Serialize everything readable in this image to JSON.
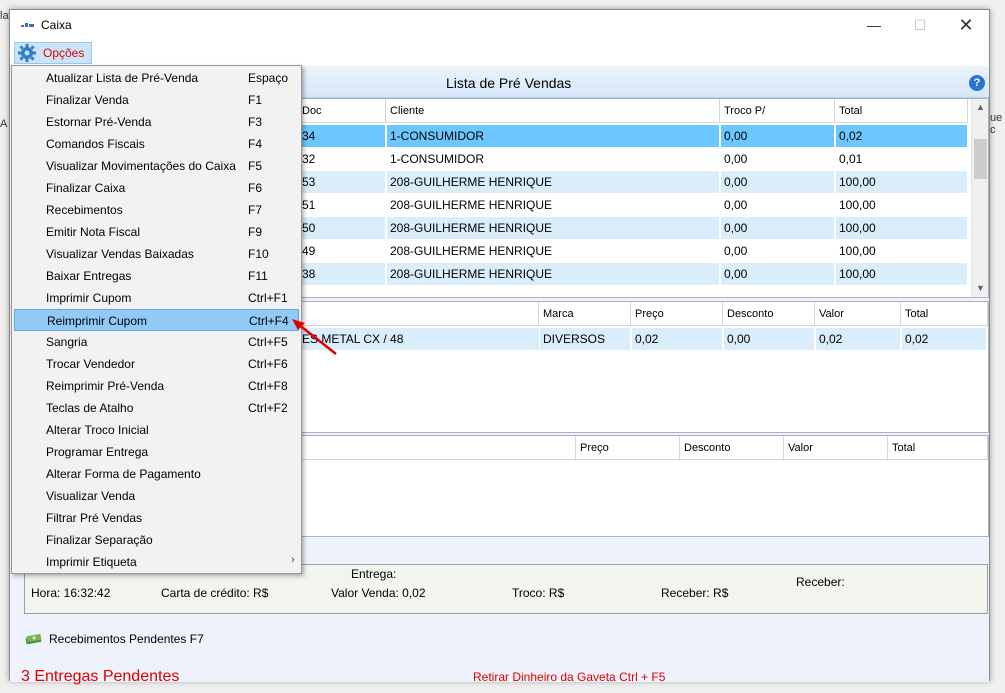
{
  "window": {
    "title": "Caixa"
  },
  "menubar": {
    "opcoes_label": "Opções"
  },
  "header": {
    "title": "Lista de Pré Vendas",
    "help": "?"
  },
  "presales_table": {
    "columns": [
      "Doc",
      "Cliente",
      "Troco P/",
      "Total"
    ],
    "rows": [
      {
        "doc": "34",
        "cliente": "1-CONSUMIDOR",
        "troco": "0,00",
        "total": "0,02",
        "selected": true
      },
      {
        "doc": "32",
        "cliente": "1-CONSUMIDOR",
        "troco": "0,00",
        "total": "0,01"
      },
      {
        "doc": "53",
        "cliente": "208-GUILHERME HENRIQUE",
        "troco": "0,00",
        "total": "100,00"
      },
      {
        "doc": "51",
        "cliente": "208-GUILHERME HENRIQUE",
        "troco": "0,00",
        "total": "100,00"
      },
      {
        "doc": "50",
        "cliente": "208-GUILHERME HENRIQUE",
        "troco": "0,00",
        "total": "100,00"
      },
      {
        "doc": "49",
        "cliente": "208-GUILHERME HENRIQUE",
        "troco": "0,00",
        "total": "100,00"
      },
      {
        "doc": "38",
        "cliente": "208-GUILHERME HENRIQUE",
        "troco": "0,00",
        "total": "100,00"
      }
    ]
  },
  "items_table": {
    "columns": [
      "Marca",
      "Preço",
      "Desconto",
      "Valor",
      "Total"
    ],
    "rows": [
      {
        "produto": "ES METAL CX / 48",
        "marca": "DIVERSOS",
        "preco": "0,02",
        "desconto": "0,00",
        "valor": "0,02",
        "total": "0,02"
      }
    ]
  },
  "third_table": {
    "columns": [
      "Preço",
      "Desconto",
      "Valor",
      "Total"
    ]
  },
  "status": {
    "entrega": "Entrega:",
    "receber": "Receber:",
    "hora": "Hora: 16:32:42",
    "carta": "Carta de crédito: R$",
    "valor_venda": "Valor Venda: 0,02",
    "troco": "Troco: R$",
    "receber_rs": "Receber: R$"
  },
  "footer": {
    "recebimentos": "Recebimentos Pendentes F7",
    "entregas": "3 Entregas Pendentes",
    "retirar": "Retirar Dinheiro da Gaveta Ctrl + F5"
  },
  "dropdown": {
    "items": [
      {
        "label": "Atualizar Lista de Pré-Venda",
        "key": "Espaço"
      },
      {
        "label": "Finalizar Venda",
        "key": "F1"
      },
      {
        "label": "Estornar Pré-Venda",
        "key": "F3"
      },
      {
        "label": "Comandos Fiscais",
        "key": "F4"
      },
      {
        "label": "Visualizar Movimentações do Caixa",
        "key": "F5"
      },
      {
        "label": "Finalizar Caixa",
        "key": "F6"
      },
      {
        "label": "Recebimentos",
        "key": "F7"
      },
      {
        "label": "Emitir Nota Fiscal",
        "key": "F9"
      },
      {
        "label": "Visualizar Vendas Baixadas",
        "key": "F10"
      },
      {
        "label": "Baixar Entregas",
        "key": "F11"
      },
      {
        "label": "Imprimir Cupom",
        "key": "Ctrl+F1"
      },
      {
        "label": "Reimprimir Cupom",
        "key": "Ctrl+F4",
        "highlighted": true
      },
      {
        "label": "Sangria",
        "key": "Ctrl+F5"
      },
      {
        "label": "Trocar Vendedor",
        "key": "Ctrl+F6"
      },
      {
        "label": "Reimprimir Pré-Venda",
        "key": "Ctrl+F8"
      },
      {
        "label": "Teclas de Atalho",
        "key": "Ctrl+F2"
      },
      {
        "label": "Alterar Troco Inicial",
        "key": ""
      },
      {
        "label": "Programar Entrega",
        "key": ""
      },
      {
        "label": "Alterar Forma de Pagamento",
        "key": ""
      },
      {
        "label": "Visualizar Venda",
        "key": ""
      },
      {
        "label": "Filtrar Pré Vendas",
        "key": ""
      },
      {
        "label": "Finalizar Separação",
        "key": ""
      },
      {
        "label": "Imprimir Etiqueta",
        "key": "",
        "submenu": true
      }
    ]
  },
  "colors": {
    "accent_red": "#e00000",
    "selected_row": "#6cc6ff",
    "alt_row": "#d9edfa",
    "menu_highlight": "#91c9f7"
  }
}
